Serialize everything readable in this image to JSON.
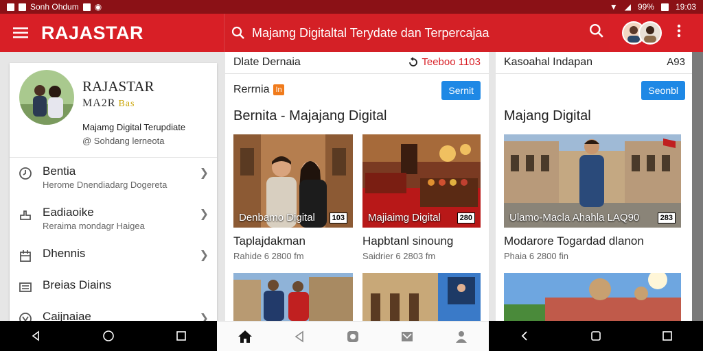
{
  "status_bar": {
    "app_label": "Sonh Ohdum",
    "battery": "99%",
    "time": "19:03"
  },
  "app_bar": {
    "brand": "RAJASTAR",
    "search_text": "Majamg Digitaltal Terydate dan Terpercajaa"
  },
  "profile": {
    "name": "RAJASTAR",
    "subtitle": "MA2R",
    "badge": "Bas",
    "line1": "Majamg Digital Terupdiate",
    "line2": "@ Sohdang lerneota"
  },
  "menu": [
    {
      "title": "Bentia",
      "subtitle": "Herome Dnendiadarg Dogereta",
      "icon": "clock-icon"
    },
    {
      "title": "Eadiaoike",
      "subtitle": "Reraima mondagr Haigea",
      "icon": "hand-icon"
    },
    {
      "title": "Dhennis",
      "subtitle": "",
      "icon": "calendar-icon"
    },
    {
      "title": "Breias Diains",
      "subtitle": "",
      "icon": "list-icon"
    },
    {
      "title": "Caijnaiae",
      "subtitle": "",
      "icon": "globe-icon"
    }
  ],
  "column1": {
    "header_left": "Dlate Dernaia",
    "header_right": "Teeboo 1103",
    "card_label": "Rerrnia",
    "tag": "In",
    "button": "Sernit",
    "section_title": "Bernita - Majajang Digital",
    "items": [
      {
        "caption": "Denbamo Digital",
        "number": "103",
        "title": "Taplajdakman",
        "subtitle": "Rahide 6 2800 fm"
      },
      {
        "caption": "Majiaimg Digital",
        "number": "280",
        "title": "Hapbtanl sinoung",
        "subtitle": "Saidrier 6 2803 fm"
      }
    ]
  },
  "column2": {
    "header_left": "Kasoahal Indapan",
    "header_right": "A93",
    "button": "Seonbl",
    "section_title": "Majang Digital",
    "items": [
      {
        "caption": "Ulamo-Macla Ahahla LAQ90",
        "number": "283",
        "title": "Modarore Togardad dlanon",
        "subtitle": "Phaia 6 2800 fin"
      }
    ]
  }
}
